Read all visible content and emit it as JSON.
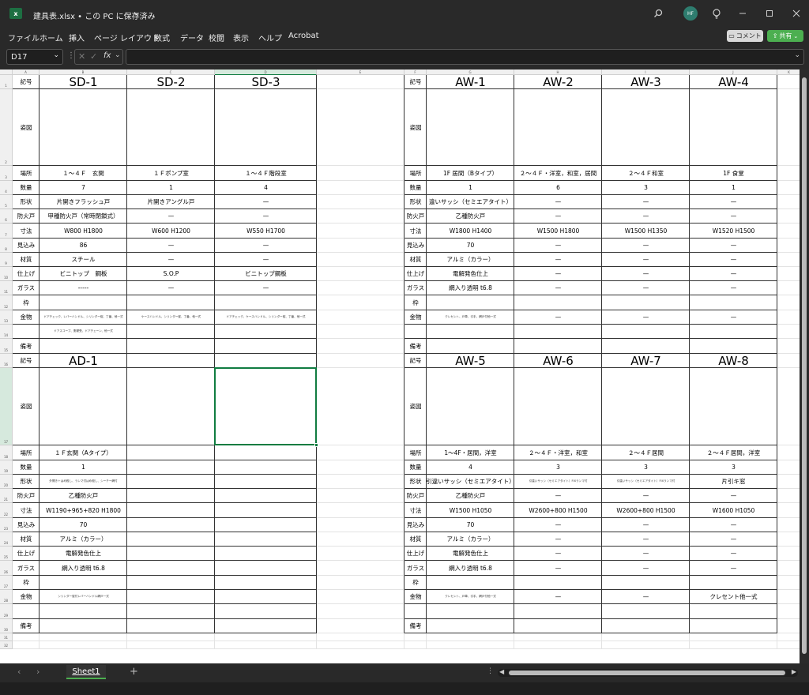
{
  "title": {
    "file": "建具表.xlsx • この PC に保存済み",
    "chevron": "⌄",
    "app_icon": "excel-icon",
    "avatar": "HF"
  },
  "menu": [
    "ファイル",
    "ホーム",
    "挿入",
    "ページ レイアウト",
    "数式",
    "データ",
    "校閲",
    "表示",
    "ヘルプ",
    "Acrobat"
  ],
  "buttons": {
    "comment": "コメント",
    "share": "共有"
  },
  "namebox": "D17",
  "fx": "fx",
  "columns": [
    "A",
    "B",
    "C",
    "D",
    "E",
    "F",
    "G",
    "H",
    "I",
    "J",
    "K"
  ],
  "rows": [
    "1",
    "2",
    "3",
    "4",
    "5",
    "6",
    "7",
    "8",
    "9",
    "10",
    "11",
    "12",
    "13",
    "14",
    "15",
    "16",
    "17",
    "18",
    "19",
    "20",
    "21",
    "22",
    "23",
    "24",
    "25",
    "26",
    "27",
    "28",
    "29",
    "30",
    "31",
    "32"
  ],
  "cells": [
    {
      "r": 1,
      "c": 0,
      "v": "記号",
      "s": "lab"
    },
    {
      "r": 1,
      "c": 1,
      "v": "SD-1",
      "s": "big"
    },
    {
      "r": 1,
      "c": 2,
      "v": "SD-2",
      "s": "big"
    },
    {
      "r": 1,
      "c": 3,
      "v": "SD-3",
      "s": "big"
    },
    {
      "r": 1,
      "c": 5,
      "v": "記号",
      "s": "lab"
    },
    {
      "r": 1,
      "c": 6,
      "v": "AW-1",
      "s": "big"
    },
    {
      "r": 1,
      "c": 7,
      "v": "AW-2",
      "s": "big"
    },
    {
      "r": 1,
      "c": 8,
      "v": "AW-3",
      "s": "big"
    },
    {
      "r": 1,
      "c": 9,
      "v": "AW-4",
      "s": "big"
    },
    {
      "r": 2,
      "c": 0,
      "v": "姿図",
      "s": "lab"
    },
    {
      "r": 2,
      "c": 5,
      "v": "姿図",
      "s": "lab"
    },
    {
      "r": 3,
      "c": 0,
      "v": "場所",
      "s": "lab"
    },
    {
      "r": 3,
      "c": 1,
      "v": "１～４Ｆ　玄関",
      "s": "val"
    },
    {
      "r": 3,
      "c": 2,
      "v": "１Ｆポンプ室",
      "s": "val"
    },
    {
      "r": 3,
      "c": 3,
      "v": "１～４Ｆ階段室",
      "s": "val"
    },
    {
      "r": 3,
      "c": 5,
      "v": "場所",
      "s": "lab"
    },
    {
      "r": 3,
      "c": 6,
      "v": "1F 居間（Bタイプ）",
      "s": "val"
    },
    {
      "r": 3,
      "c": 7,
      "v": "２～４Ｆ・洋室，和室，居間",
      "s": "val"
    },
    {
      "r": 3,
      "c": 8,
      "v": "２～４Ｆ和室",
      "s": "val"
    },
    {
      "r": 3,
      "c": 9,
      "v": "1F 食堂",
      "s": "val"
    },
    {
      "r": 4,
      "c": 0,
      "v": "数量",
      "s": "lab"
    },
    {
      "r": 4,
      "c": 1,
      "v": "7",
      "s": "val"
    },
    {
      "r": 4,
      "c": 2,
      "v": "1",
      "s": "val"
    },
    {
      "r": 4,
      "c": 3,
      "v": "4",
      "s": "val"
    },
    {
      "r": 4,
      "c": 5,
      "v": "数量",
      "s": "lab"
    },
    {
      "r": 4,
      "c": 6,
      "v": "1",
      "s": "val"
    },
    {
      "r": 4,
      "c": 7,
      "v": "6",
      "s": "val"
    },
    {
      "r": 4,
      "c": 8,
      "v": "3",
      "s": "val"
    },
    {
      "r": 4,
      "c": 9,
      "v": "1",
      "s": "val"
    },
    {
      "r": 5,
      "c": 0,
      "v": "形状",
      "s": "lab"
    },
    {
      "r": 5,
      "c": 1,
      "v": "片開きフラッシュ戸",
      "s": "val"
    },
    {
      "r": 5,
      "c": 2,
      "v": "片開きアングル戸",
      "s": "val"
    },
    {
      "r": 5,
      "c": 3,
      "v": "—",
      "s": "val"
    },
    {
      "r": 5,
      "c": 5,
      "v": "形状",
      "s": "lab"
    },
    {
      "r": 5,
      "c": 6,
      "v": "違いサッシ（セミエアタイト）",
      "s": "val"
    },
    {
      "r": 5,
      "c": 7,
      "v": "—",
      "s": "val"
    },
    {
      "r": 5,
      "c": 8,
      "v": "—",
      "s": "val"
    },
    {
      "r": 5,
      "c": 9,
      "v": "—",
      "s": "val"
    },
    {
      "r": 6,
      "c": 0,
      "v": "防火戸",
      "s": "lab"
    },
    {
      "r": 6,
      "c": 1,
      "v": "甲種防火戸（常時閉鎖式）",
      "s": "val"
    },
    {
      "r": 6,
      "c": 2,
      "v": "—",
      "s": "val"
    },
    {
      "r": 6,
      "c": 3,
      "v": "—",
      "s": "val"
    },
    {
      "r": 6,
      "c": 5,
      "v": "防火戸",
      "s": "lab"
    },
    {
      "r": 6,
      "c": 6,
      "v": "乙種防火戸",
      "s": "val"
    },
    {
      "r": 6,
      "c": 7,
      "v": "—",
      "s": "val"
    },
    {
      "r": 6,
      "c": 8,
      "v": "—",
      "s": "val"
    },
    {
      "r": 6,
      "c": 9,
      "v": "—",
      "s": "val"
    },
    {
      "r": 7,
      "c": 0,
      "v": "寸法",
      "s": "lab"
    },
    {
      "r": 7,
      "c": 1,
      "v": "W800 H1800",
      "s": "val"
    },
    {
      "r": 7,
      "c": 2,
      "v": "W600 H1200",
      "s": "val"
    },
    {
      "r": 7,
      "c": 3,
      "v": "W550 H1700",
      "s": "val"
    },
    {
      "r": 7,
      "c": 5,
      "v": "寸法",
      "s": "lab"
    },
    {
      "r": 7,
      "c": 6,
      "v": "W1800 H1400",
      "s": "val"
    },
    {
      "r": 7,
      "c": 7,
      "v": "W1500 H1800",
      "s": "val"
    },
    {
      "r": 7,
      "c": 8,
      "v": "W1500 H1350",
      "s": "val"
    },
    {
      "r": 7,
      "c": 9,
      "v": "W1520 H1500",
      "s": "val"
    },
    {
      "r": 8,
      "c": 0,
      "v": "見込み",
      "s": "lab"
    },
    {
      "r": 8,
      "c": 1,
      "v": "86",
      "s": "val"
    },
    {
      "r": 8,
      "c": 2,
      "v": "—",
      "s": "val"
    },
    {
      "r": 8,
      "c": 3,
      "v": "—",
      "s": "val"
    },
    {
      "r": 8,
      "c": 5,
      "v": "見込み",
      "s": "lab"
    },
    {
      "r": 8,
      "c": 6,
      "v": "70",
      "s": "val"
    },
    {
      "r": 8,
      "c": 7,
      "v": "—",
      "s": "val"
    },
    {
      "r": 8,
      "c": 8,
      "v": "—",
      "s": "val"
    },
    {
      "r": 8,
      "c": 9,
      "v": "—",
      "s": "val"
    },
    {
      "r": 9,
      "c": 0,
      "v": "材質",
      "s": "lab"
    },
    {
      "r": 9,
      "c": 1,
      "v": "スチール",
      "s": "val"
    },
    {
      "r": 9,
      "c": 2,
      "v": "—",
      "s": "val"
    },
    {
      "r": 9,
      "c": 3,
      "v": "—",
      "s": "val"
    },
    {
      "r": 9,
      "c": 5,
      "v": "材質",
      "s": "lab"
    },
    {
      "r": 9,
      "c": 6,
      "v": "アルミ（カラー）",
      "s": "val"
    },
    {
      "r": 9,
      "c": 7,
      "v": "—",
      "s": "val"
    },
    {
      "r": 9,
      "c": 8,
      "v": "—",
      "s": "val"
    },
    {
      "r": 9,
      "c": 9,
      "v": "—",
      "s": "val"
    },
    {
      "r": 10,
      "c": 0,
      "v": "仕上げ",
      "s": "lab"
    },
    {
      "r": 10,
      "c": 1,
      "v": "ビニトップ　鋼板",
      "s": "val"
    },
    {
      "r": 10,
      "c": 2,
      "v": "S.O.P",
      "s": "val"
    },
    {
      "r": 10,
      "c": 3,
      "v": "ビニトップ鋼板",
      "s": "val"
    },
    {
      "r": 10,
      "c": 5,
      "v": "仕上げ",
      "s": "lab"
    },
    {
      "r": 10,
      "c": 6,
      "v": "電解発色仕上",
      "s": "val"
    },
    {
      "r": 10,
      "c": 7,
      "v": "—",
      "s": "val"
    },
    {
      "r": 10,
      "c": 8,
      "v": "—",
      "s": "val"
    },
    {
      "r": 10,
      "c": 9,
      "v": "—",
      "s": "val"
    },
    {
      "r": 11,
      "c": 0,
      "v": "ガラス",
      "s": "lab"
    },
    {
      "r": 11,
      "c": 1,
      "v": "-----",
      "s": "val"
    },
    {
      "r": 11,
      "c": 2,
      "v": "—",
      "s": "val"
    },
    {
      "r": 11,
      "c": 3,
      "v": "—",
      "s": "val"
    },
    {
      "r": 11,
      "c": 5,
      "v": "ガラス",
      "s": "lab"
    },
    {
      "r": 11,
      "c": 6,
      "v": "網入り透明 t6.8",
      "s": "val"
    },
    {
      "r": 11,
      "c": 7,
      "v": "—",
      "s": "val"
    },
    {
      "r": 11,
      "c": 8,
      "v": "—",
      "s": "val"
    },
    {
      "r": 11,
      "c": 9,
      "v": "—",
      "s": "val"
    },
    {
      "r": 12,
      "c": 0,
      "v": "枠",
      "s": "lab"
    },
    {
      "r": 12,
      "c": 5,
      "v": "枠",
      "s": "lab"
    },
    {
      "r": 13,
      "c": 0,
      "v": "金物",
      "s": "lab"
    },
    {
      "r": 13,
      "c": 1,
      "v": "ドアチェック、レバーハンドル、シリンダー錠、丁番、他一式",
      "s": "tiny"
    },
    {
      "r": 13,
      "c": 2,
      "v": "ケースハンドル、シリンダー錠、丁番、他一式",
      "s": "tiny"
    },
    {
      "r": 13,
      "c": 3,
      "v": "ドアチェック、ケースハンドル、シリンダー錠、丁番、他一式",
      "s": "tiny"
    },
    {
      "r": 13,
      "c": 5,
      "v": "金物",
      "s": "lab"
    },
    {
      "r": 13,
      "c": 6,
      "v": "クレセント、戸車、引手、網戸付他一式",
      "s": "tiny"
    },
    {
      "r": 13,
      "c": 7,
      "v": "—",
      "s": "val"
    },
    {
      "r": 13,
      "c": 8,
      "v": "—",
      "s": "val"
    },
    {
      "r": 13,
      "c": 9,
      "v": "—",
      "s": "val"
    },
    {
      "r": 14,
      "c": 1,
      "v": "ドアスコープ、郵便受、ドアチェーン、他一式",
      "s": "tiny"
    },
    {
      "r": 15,
      "c": 0,
      "v": "備考",
      "s": "lab"
    },
    {
      "r": 15,
      "c": 5,
      "v": "備考",
      "s": "lab"
    },
    {
      "r": 16,
      "c": 0,
      "v": "記号",
      "s": "lab"
    },
    {
      "r": 16,
      "c": 1,
      "v": "AD-1",
      "s": "big"
    },
    {
      "r": 16,
      "c": 5,
      "v": "記号",
      "s": "lab"
    },
    {
      "r": 16,
      "c": 6,
      "v": "AW-5",
      "s": "big"
    },
    {
      "r": 16,
      "c": 7,
      "v": "AW-6",
      "s": "big"
    },
    {
      "r": 16,
      "c": 8,
      "v": "AW-7",
      "s": "big"
    },
    {
      "r": 16,
      "c": 9,
      "v": "AW-8",
      "s": "big"
    },
    {
      "r": 17,
      "c": 0,
      "v": "姿図",
      "s": "lab"
    },
    {
      "r": 17,
      "c": 5,
      "v": "姿図",
      "s": "lab"
    },
    {
      "r": 18,
      "c": 0,
      "v": "場所",
      "s": "lab"
    },
    {
      "r": 18,
      "c": 1,
      "v": "１Ｆ玄関（Aタイプ）",
      "s": "val"
    },
    {
      "r": 18,
      "c": 5,
      "v": "場所",
      "s": "lab"
    },
    {
      "r": 18,
      "c": 6,
      "v": "1～4F・居間，洋室",
      "s": "val"
    },
    {
      "r": 18,
      "c": 7,
      "v": "２～４Ｆ・洋室，和室",
      "s": "val"
    },
    {
      "r": 18,
      "c": 8,
      "v": "２～４Ｆ居間",
      "s": "val"
    },
    {
      "r": 18,
      "c": 9,
      "v": "２～４Ｆ居間，洋室",
      "s": "val"
    },
    {
      "r": 19,
      "c": 0,
      "v": "数量",
      "s": "lab"
    },
    {
      "r": 19,
      "c": 1,
      "v": "1",
      "s": "val"
    },
    {
      "r": 19,
      "c": 5,
      "v": "数量",
      "s": "lab"
    },
    {
      "r": 19,
      "c": 6,
      "v": "4",
      "s": "val"
    },
    {
      "r": 19,
      "c": 7,
      "v": "3",
      "s": "val"
    },
    {
      "r": 19,
      "c": 8,
      "v": "3",
      "s": "val"
    },
    {
      "r": 19,
      "c": 9,
      "v": "3",
      "s": "val"
    },
    {
      "r": 20,
      "c": 0,
      "v": "形状",
      "s": "lab"
    },
    {
      "r": 20,
      "c": 1,
      "v": "外開き＋はめ殺し、ランマ付はめ殺し、シーチー網付",
      "s": "tiny"
    },
    {
      "r": 20,
      "c": 5,
      "v": "形状",
      "s": "lab"
    },
    {
      "r": 20,
      "c": 6,
      "v": "引違いサッシ（セミエアタイト）",
      "s": "val"
    },
    {
      "r": 20,
      "c": 7,
      "v": "引違いサッシ（セミエアタイト）FIXランマ付",
      "s": "tiny"
    },
    {
      "r": 20,
      "c": 8,
      "v": "引違いサッシ（セミエアタイト）FIXランマ付",
      "s": "tiny"
    },
    {
      "r": 20,
      "c": 9,
      "v": "片引キ窓",
      "s": "val"
    },
    {
      "r": 21,
      "c": 0,
      "v": "防火戸",
      "s": "lab"
    },
    {
      "r": 21,
      "c": 1,
      "v": "乙種防火戸",
      "s": "val"
    },
    {
      "r": 21,
      "c": 5,
      "v": "防火戸",
      "s": "lab"
    },
    {
      "r": 21,
      "c": 6,
      "v": "乙種防火戸",
      "s": "val"
    },
    {
      "r": 21,
      "c": 7,
      "v": "—",
      "s": "val"
    },
    {
      "r": 21,
      "c": 8,
      "v": "—",
      "s": "val"
    },
    {
      "r": 21,
      "c": 9,
      "v": "—",
      "s": "val"
    },
    {
      "r": 22,
      "c": 0,
      "v": "寸法",
      "s": "lab"
    },
    {
      "r": 22,
      "c": 1,
      "v": "W1190+965+820 H1800",
      "s": "val"
    },
    {
      "r": 22,
      "c": 5,
      "v": "寸法",
      "s": "lab"
    },
    {
      "r": 22,
      "c": 6,
      "v": "W1500 H1050",
      "s": "val"
    },
    {
      "r": 22,
      "c": 7,
      "v": "W2600+800 H1500",
      "s": "val"
    },
    {
      "r": 22,
      "c": 8,
      "v": "W2600+800 H1500",
      "s": "val"
    },
    {
      "r": 22,
      "c": 9,
      "v": "W1600 H1050",
      "s": "val"
    },
    {
      "r": 23,
      "c": 0,
      "v": "見込み",
      "s": "lab"
    },
    {
      "r": 23,
      "c": 1,
      "v": "70",
      "s": "val"
    },
    {
      "r": 23,
      "c": 5,
      "v": "見込み",
      "s": "lab"
    },
    {
      "r": 23,
      "c": 6,
      "v": "70",
      "s": "val"
    },
    {
      "r": 23,
      "c": 7,
      "v": "—",
      "s": "val"
    },
    {
      "r": 23,
      "c": 8,
      "v": "—",
      "s": "val"
    },
    {
      "r": 23,
      "c": 9,
      "v": "—",
      "s": "val"
    },
    {
      "r": 24,
      "c": 0,
      "v": "材質",
      "s": "lab"
    },
    {
      "r": 24,
      "c": 1,
      "v": "アルミ（カラー）",
      "s": "val"
    },
    {
      "r": 24,
      "c": 5,
      "v": "材質",
      "s": "lab"
    },
    {
      "r": 24,
      "c": 6,
      "v": "アルミ（カラー）",
      "s": "val"
    },
    {
      "r": 24,
      "c": 7,
      "v": "—",
      "s": "val"
    },
    {
      "r": 24,
      "c": 8,
      "v": "—",
      "s": "val"
    },
    {
      "r": 24,
      "c": 9,
      "v": "—",
      "s": "val"
    },
    {
      "r": 25,
      "c": 0,
      "v": "仕上げ",
      "s": "lab"
    },
    {
      "r": 25,
      "c": 1,
      "v": "電解発色仕上",
      "s": "val"
    },
    {
      "r": 25,
      "c": 5,
      "v": "仕上げ",
      "s": "lab"
    },
    {
      "r": 25,
      "c": 6,
      "v": "電解発色仕上",
      "s": "val"
    },
    {
      "r": 25,
      "c": 7,
      "v": "—",
      "s": "val"
    },
    {
      "r": 25,
      "c": 8,
      "v": "—",
      "s": "val"
    },
    {
      "r": 25,
      "c": 9,
      "v": "—",
      "s": "val"
    },
    {
      "r": 26,
      "c": 0,
      "v": "ガラス",
      "s": "lab"
    },
    {
      "r": 26,
      "c": 1,
      "v": "網入り透明 t6.8",
      "s": "val"
    },
    {
      "r": 26,
      "c": 5,
      "v": "ガラス",
      "s": "lab"
    },
    {
      "r": 26,
      "c": 6,
      "v": "網入り透明 t6.8",
      "s": "val"
    },
    {
      "r": 26,
      "c": 7,
      "v": "—",
      "s": "val"
    },
    {
      "r": 26,
      "c": 8,
      "v": "—",
      "s": "val"
    },
    {
      "r": 26,
      "c": 9,
      "v": "—",
      "s": "val"
    },
    {
      "r": 27,
      "c": 0,
      "v": "枠",
      "s": "lab"
    },
    {
      "r": 27,
      "c": 5,
      "v": "枠",
      "s": "lab"
    },
    {
      "r": 28,
      "c": 0,
      "v": "金物",
      "s": "lab"
    },
    {
      "r": 28,
      "c": 1,
      "v": "シリンダー錠付レバーハンドル網戸一式",
      "s": "tiny"
    },
    {
      "r": 28,
      "c": 5,
      "v": "金物",
      "s": "lab"
    },
    {
      "r": 28,
      "c": 6,
      "v": "クレセント、戸車、引手、網戸付他一式",
      "s": "tiny"
    },
    {
      "r": 28,
      "c": 7,
      "v": "—",
      "s": "val"
    },
    {
      "r": 28,
      "c": 8,
      "v": "—",
      "s": "val"
    },
    {
      "r": 28,
      "c": 9,
      "v": "クレセント他一式",
      "s": "val"
    },
    {
      "r": 30,
      "c": 0,
      "v": "備考",
      "s": "lab"
    },
    {
      "r": 30,
      "c": 5,
      "v": "備考",
      "s": "lab"
    }
  ],
  "sheet_tab": "Sheet1",
  "colors": {
    "excel_green": "#1d6f42",
    "share_green": "#4caf50",
    "selection": "#107c41",
    "avatar": "#2e7d6f"
  }
}
